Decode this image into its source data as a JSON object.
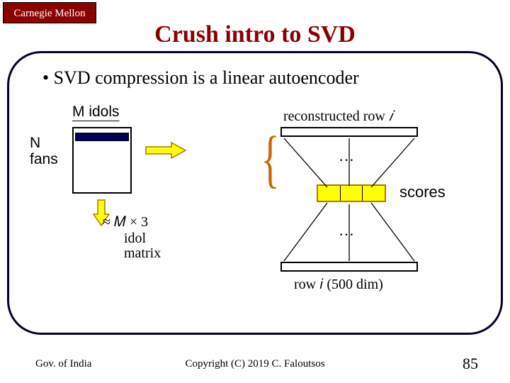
{
  "logo": "Carnegie Mellon",
  "title": "Crush intro to SVD",
  "bullet": "• SVD compression is a linear autoencoder",
  "labels": {
    "m_idols": "M idols",
    "n_fans": "N\nfans",
    "scores": "scores",
    "dots": "…"
  },
  "formulas": {
    "approx": "≈ 𝑀 × 3",
    "idol_matrix": "idol\nmatrix",
    "reconstructed": "reconstructed row",
    "reconstructed_i": "𝑖",
    "row_i": "row 𝑖 (500 dim)"
  },
  "footer": {
    "left": "Gov. of India",
    "center": "Copyright (C) 2019 C. Faloutsos",
    "right": "85"
  }
}
